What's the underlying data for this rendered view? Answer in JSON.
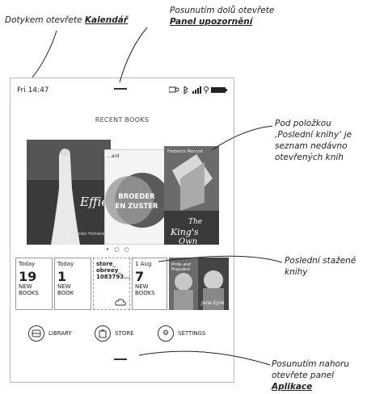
{
  "annotations": {
    "calendar_text": "Dotykem otevřete",
    "calendar_link": "Kalendář",
    "notif_line1": "Posunutím dolů otevřete",
    "notif_link": "Panel upozornění",
    "recent_line1": "Pod položkou",
    "recent_line2": "‚Poslední knihy‘ je",
    "recent_line3": "seznam nedávno",
    "recent_line4": "otevřených knih",
    "downloads_line1": "Poslední stažené",
    "downloads_line2": "knihy",
    "apps_line1": "Posunutím nahoru",
    "apps_line2": "otevřete panel",
    "apps_link": "Aplikace"
  },
  "status_bar": {
    "time": "Fri 14:47",
    "icons": [
      "sync-icon",
      "bluetooth-icon",
      "signal-icon",
      "location-icon",
      "battery-icon"
    ]
  },
  "recent": {
    "title": "RECENT BOOKS",
    "covers": [
      {
        "title": "Effie Briest",
        "author": "Theodor Fontane"
      },
      {
        "title": "BROEDER EN ZUSTER",
        "top": "...ard"
      },
      {
        "title": "The King's Own",
        "author": "Frederick Marryat"
      }
    ],
    "pager": "• ○ ○"
  },
  "tiles": [
    {
      "header": "Today",
      "count": "19",
      "line1": "NEW",
      "line2": "BOOKS"
    },
    {
      "header": "Today",
      "count": "1",
      "line1": "NEW",
      "line2": "BOOK"
    },
    {
      "header": "store_",
      "line1": "obreey_",
      "line2": "1083793..."
    },
    {
      "header": "1 Aug",
      "count": "7",
      "line1": "NEW",
      "line2": "BOOKS"
    }
  ],
  "nav": {
    "library": "LIBRARY",
    "store": "STORE",
    "settings": "SETTINGS"
  }
}
